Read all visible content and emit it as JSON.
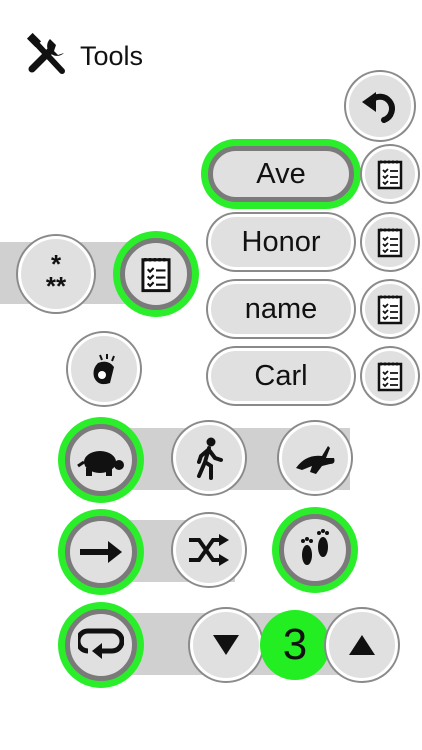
{
  "header": {
    "title": "Tools",
    "icon": "tools-icon"
  },
  "names": [
    {
      "label": "Ave",
      "active": true
    },
    {
      "label": "Honor",
      "active": false
    },
    {
      "label": "name",
      "active": false
    },
    {
      "label": "Carl",
      "active": false
    }
  ],
  "password_icon_text": "*\n**",
  "speed": {
    "options": [
      "slow",
      "walk",
      "fast"
    ],
    "selected": "slow"
  },
  "order": {
    "options": [
      "sequential",
      "shuffle",
      "manual-steps"
    ],
    "selected": [
      "sequential",
      "manual-steps"
    ]
  },
  "repeat": {
    "count": "3",
    "active": true
  },
  "colors": {
    "active_ring": "#2bee2b",
    "counter": "#22ee22",
    "strip": "#d0d0d0",
    "button_fill": "#e0e0e0"
  }
}
